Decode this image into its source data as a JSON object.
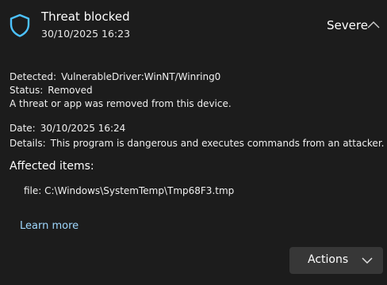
{
  "header": {
    "title": "Threat blocked",
    "datetime": "30/10/2025 16:23",
    "severity": "Severe",
    "shield_icon": "shield-icon",
    "expand_icon": "chevron-up-icon",
    "accent_color": "#4cc2ff"
  },
  "details": {
    "detected_label": "Detected:",
    "detected_value": "VulnerableDriver:WinNT/Winring0",
    "status_label": "Status:",
    "status_value": "Removed",
    "status_message": "A threat or app was removed from this device.",
    "date_label": "Date:",
    "date_value": "30/10/2025 16:24",
    "details_label": "Details:",
    "details_value": "This program is dangerous and executes commands from an attacker."
  },
  "affected": {
    "heading": "Affected items:",
    "items": [
      {
        "prefix": "file:",
        "path": "C:\\Windows\\SystemTemp\\Tmp68F3.tmp"
      }
    ]
  },
  "links": {
    "learn_more": "Learn more",
    "link_color": "#9fd8ff"
  },
  "actions": {
    "label": "Actions",
    "icon": "chevron-down-icon"
  }
}
